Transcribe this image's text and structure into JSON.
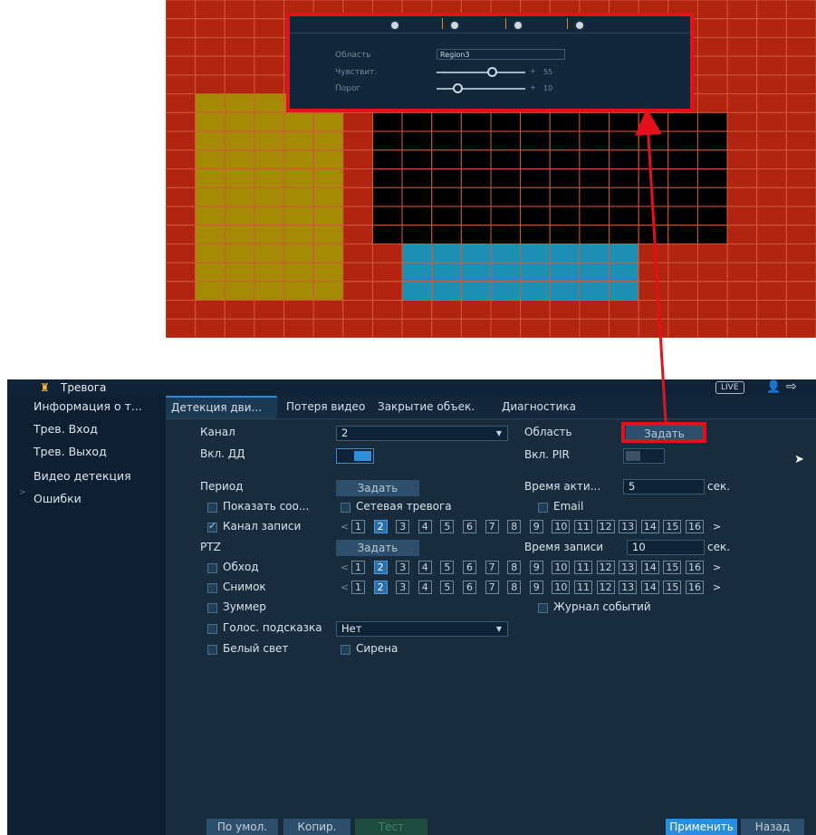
{
  "popup": {
    "labels": [
      "Область",
      "Чувствит.",
      "Порог"
    ],
    "region_value": "Region3",
    "sensitivity_value": "55",
    "threshold_value": "10"
  },
  "titlebar": {
    "title": "Тревога",
    "live": "LIVE"
  },
  "sidebar": {
    "items": [
      {
        "label": "Информация о т..."
      },
      {
        "label": "Трев. Вход"
      },
      {
        "label": "Трев. Выход"
      },
      {
        "label": "Видео детекция"
      },
      {
        "label": "Ошибки"
      }
    ]
  },
  "tabs": [
    {
      "label": "Детекция дви..."
    },
    {
      "label": "Потеря видео"
    },
    {
      "label": "Закрытие объек."
    },
    {
      "label": "Диагностика"
    }
  ],
  "form": {
    "channel_label": "Канал",
    "channel_value": "2",
    "area_label": "Область",
    "area_button": "Задать",
    "md_label": "Вкл. ДД",
    "pir_label": "Вкл. PIR",
    "period_label": "Период",
    "period_button": "Задать",
    "active_time_label": "Время акти...",
    "active_time_value": "5",
    "sec1": "сек.",
    "show_msg_label": "Показать соо...",
    "net_alarm_label": "Сетевая тревога",
    "email_label": "Email",
    "record_channel_label": "Канал записи",
    "ptz_label": "PTZ",
    "ptz_button": "Задать",
    "record_time_label": "Время записи",
    "record_time_value": "10",
    "sec2": "сек.",
    "tour_label": "Обход",
    "snapshot_label": "Снимок",
    "buzzer_label": "Зуммер",
    "event_log_label": "Журнал событий",
    "voice_prompt_label": "Голос. подсказка",
    "voice_prompt_value": "Нет",
    "white_light_label": "Белый свет",
    "siren_label": "Сирена",
    "channels": [
      "1",
      "2",
      "3",
      "4",
      "5",
      "6",
      "7",
      "8",
      "9",
      "10",
      "11",
      "12",
      "13",
      "14",
      "15",
      "16"
    ],
    "prev": "<",
    "next": ">"
  },
  "bottom": {
    "default": "По умол.",
    "copy": "Копир.",
    "test": "Тест",
    "apply": "Применить",
    "back": "Назад"
  }
}
